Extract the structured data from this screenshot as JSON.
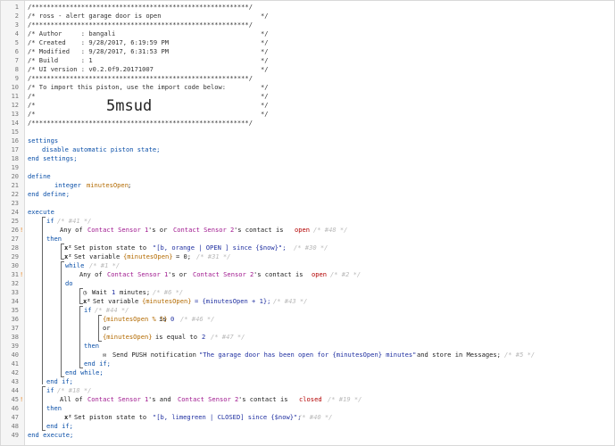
{
  "line_numbers": [
    "1",
    "2",
    "3",
    "4",
    "5",
    "6",
    "7",
    "8",
    "9",
    "10",
    "11",
    "12",
    "13",
    "14",
    "15",
    "16",
    "17",
    "18",
    "19",
    "20",
    "21",
    "22",
    "23",
    "24",
    "25",
    "26",
    "27",
    "28",
    "29",
    "30",
    "31",
    "32",
    "33",
    "34",
    "35",
    "36",
    "37",
    "38",
    "39",
    "40",
    "41",
    "42",
    "43",
    "44",
    "45",
    "46",
    "47",
    "48",
    "49"
  ],
  "header": {
    "l1": "/*********************************************************/",
    "l2a": "/* ross - alert garage door is open",
    "l2b": "*/",
    "l3": "/*********************************************************/",
    "l4a": "/* Author     : bangali",
    "l4b": "*/",
    "l5a": "/* Created    : 9/28/2017, 6:19:59 PM",
    "l5b": "*/",
    "l6a": "/* Modified   : 9/28/2017, 6:31:53 PM",
    "l6b": "*/",
    "l7a": "/* Build      : 1",
    "l7b": "*/",
    "l8a": "/* UI version : v0.2.0f9.20171007",
    "l8b": "*/",
    "l9": "/*********************************************************/",
    "l10a": "/* To import this piston, use the import code below:",
    "l10b": "*/",
    "l11a": "/*",
    "l11b": "*/",
    "l12a": "/*",
    "l12b": "*/",
    "l13a": "/*",
    "l13b": "*/",
    "l14": "/*********************************************************/",
    "import_code": "5msud"
  },
  "code": {
    "settings": "settings",
    "disable": "disable automatic piston state;",
    "end_settings": "end settings;",
    "define": "define",
    "integer": "integer",
    "minutesOpen_decl": "minutesOpen",
    "semi": ";",
    "end_define": "end define;",
    "execute": "execute",
    "if": "if",
    "c41": "/* #41 */",
    "any_of": "Any of",
    "cs1": "Contact Sensor 1",
    "s_or": "'s or",
    "cs2": "Contact Sensor 2",
    "s_contact_is": "'s contact is",
    "open": "open",
    "c48": "/* #48 */",
    "then": "then",
    "set_state": "Set piston state to",
    "state1": "\"[b, orange | OPEN ] since {$now}\";",
    "c30": "/* #30 */",
    "set_var": "Set variable",
    "var_mo": "{minutesOpen}",
    "eq0": "= 0;",
    "c31": "/* #31 */",
    "while": "while",
    "c1": "/* #1 */",
    "c2": "/* #2 */",
    "do": "do",
    "wait": "Wait",
    "one": "1",
    "minutes": "minutes;",
    "c6": "/* #6 */",
    "eq_expr": "= {minutesOpen + 1};",
    "c43": "/* #43 */",
    "c44": "/* #44 */",
    "cond1": "{minutesOpen % 5}",
    "is": "is",
    "zero": "0",
    "c46": "/* #46 */",
    "or": "or",
    "equal_to": "is equal to",
    "two": "2",
    "c47": "/* #47 */",
    "send_push": "Send PUSH notification",
    "msg": "\"The garage door has been open for {minutesOpen} minutes\"",
    "store": "and store in Messages;",
    "c5": "/* #5 */",
    "end_if": "end if;",
    "end_while": "end while;",
    "c18": "/* #18 */",
    "all_of": "All of",
    "s_and": "'s and",
    "closed": "closed",
    "c19": "/* #19 */",
    "state2": "\"[b, limegreen | CLOSED] since {$now}\";",
    "c40": "/* #40 */",
    "end_execute": "end execute;"
  },
  "gutter_markers": {
    "l26": "!",
    "l29": "!",
    "l45": "!"
  },
  "colors": {
    "keyword": "#0a4fa8",
    "device": "#a0198f",
    "variable": "#b36a00",
    "comment": "#b8b8b8",
    "value": "#b30000"
  }
}
